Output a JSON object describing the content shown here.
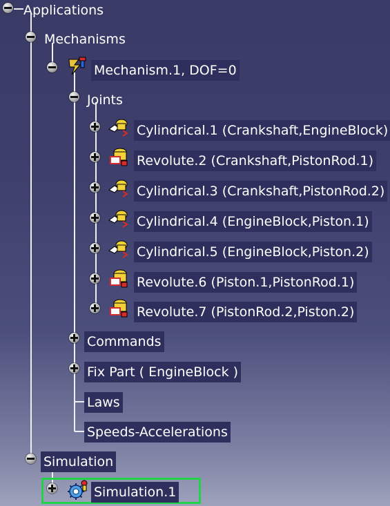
{
  "tree": {
    "root": {
      "label": "Applications"
    },
    "mechanisms": {
      "label": "Mechanisms"
    },
    "mechanism": {
      "label": "Mechanism.1, DOF=0",
      "icon": "mechanism-icon"
    },
    "joints": {
      "label": "Joints",
      "items": [
        {
          "label": "Cylindrical.1 (Crankshaft,EngineBlock)",
          "icon": "cylindrical-joint-icon"
        },
        {
          "label": "Revolute.2 (Crankshaft,PistonRod.1)",
          "icon": "revolute-joint-icon"
        },
        {
          "label": "Cylindrical.3 (Crankshaft,PistonRod.2)",
          "icon": "cylindrical-joint-icon"
        },
        {
          "label": "Cylindrical.4 (EngineBlock,Piston.1)",
          "icon": "cylindrical-joint-icon"
        },
        {
          "label": "Cylindrical.5 (EngineBlock,Piston.2)",
          "icon": "cylindrical-joint-icon"
        },
        {
          "label": "Revolute.6 (Piston.1,PistonRod.1)",
          "icon": "revolute-joint-icon"
        },
        {
          "label": "Revolute.7 (PistonRod.2,Piston.2)",
          "icon": "revolute-joint-icon"
        }
      ]
    },
    "commands": {
      "label": "Commands"
    },
    "fix_part": {
      "label": "Fix Part ( EngineBlock )"
    },
    "laws": {
      "label": "Laws"
    },
    "speeds": {
      "label": "Speeds-Accelerations"
    },
    "simulation": {
      "label": "Simulation"
    },
    "simulation_item": {
      "label": "Simulation.1",
      "icon": "simulation-icon",
      "selected": true
    }
  },
  "colors": {
    "background_top": "#3a3a66",
    "background_bottom": "#9ea2bb",
    "label_background": "#2e2f5c",
    "label_text": "#ffffff",
    "selection_border": "#22d34a"
  }
}
